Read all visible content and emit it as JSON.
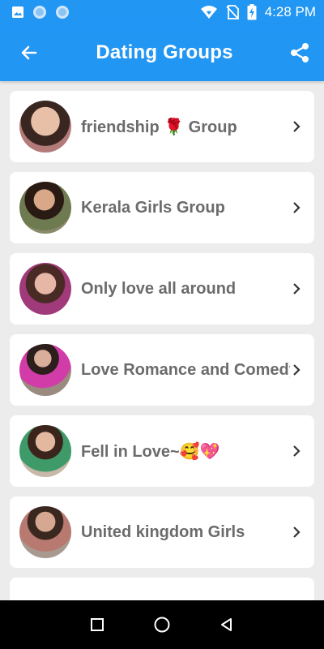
{
  "status_bar": {
    "time": "4:28 PM",
    "icons": [
      "gallery-icon",
      "circle-icon",
      "circle-icon",
      "wifi-icon",
      "no-sim-icon",
      "battery-charging-icon"
    ]
  },
  "app_bar": {
    "title": "Dating Groups",
    "back_icon": "arrow-left-icon",
    "share_icon": "share-icon",
    "color": "#2196f3"
  },
  "groups": [
    {
      "label": "friendship 🌹 Group"
    },
    {
      "label": "Kerala Girls Group"
    },
    {
      "label": "Only love all around"
    },
    {
      "label": "Love Romance and Comedy"
    },
    {
      "label": "Fell in Love~🥰💖"
    },
    {
      "label": "United kingdom Girls"
    }
  ],
  "nav_bar": {
    "icons": [
      "recent-apps-icon",
      "home-icon",
      "back-icon"
    ]
  }
}
